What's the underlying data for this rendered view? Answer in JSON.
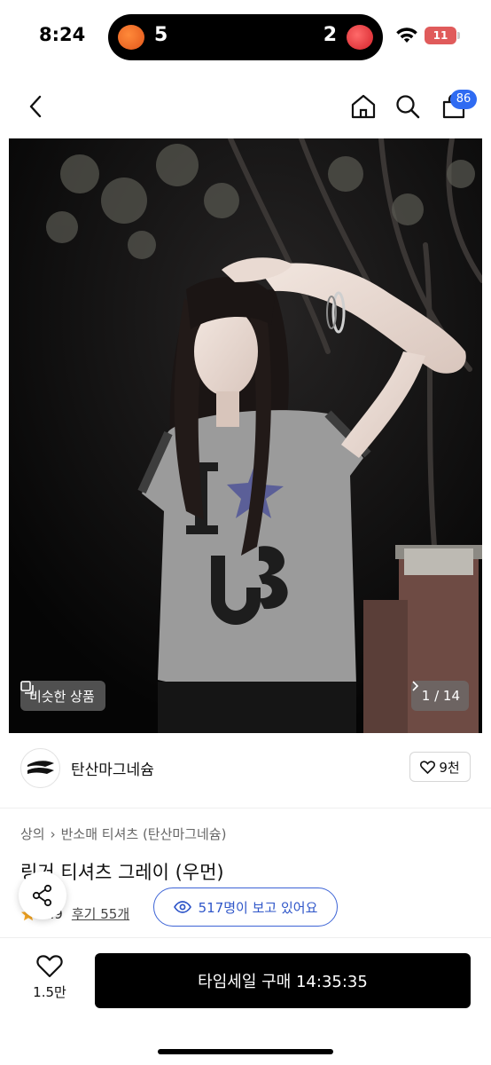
{
  "status_bar": {
    "time": "8:24",
    "live_activity": {
      "left_score": "5",
      "right_score": "2",
      "left_team_icon": "eagles-logo-icon",
      "right_team_icon": "landers-logo-icon"
    },
    "battery": "11"
  },
  "nav": {
    "icons": [
      "chevron-left-icon",
      "home-icon",
      "search-icon",
      "shopping-bag-icon"
    ],
    "cart_count": "86"
  },
  "gallery": {
    "similar_label": "비슷한 상품",
    "page_indicator": "1 / 14",
    "shirt_print": "I ★ ts"
  },
  "shop": {
    "name": "탄산마그네슘",
    "likes": "9천"
  },
  "product": {
    "breadcrumb": [
      "상의",
      "반소매 티셔츠 (탄산마그네슘)"
    ],
    "title": "링거 티셔츠 그레이 (우먼)",
    "rating": "4.9",
    "reviews": "후기 55개",
    "viewers": "517명이 보고 있어요"
  },
  "bottom_bar": {
    "wish_count": "1.5만",
    "buy_label": "타임세일 구매 14:35:35"
  },
  "colors": {
    "accent_blue": "#2f6bf2",
    "viewer_blue": "#3d64d6",
    "star": "#f5a623",
    "buy_button": "#000000"
  }
}
